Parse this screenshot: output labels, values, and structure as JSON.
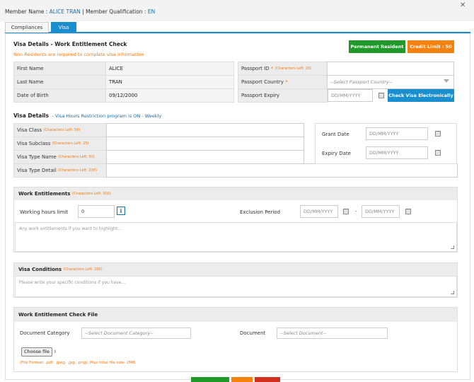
{
  "header": {
    "member_name_label": "Member Name : ",
    "member_name": "ALICE TRAN",
    "separator": " | ",
    "qual_label": "Member Qualification : ",
    "qual": "EN"
  },
  "tabs": [
    {
      "label": "Compliances"
    },
    {
      "label": "Visa"
    }
  ],
  "visa": {
    "title": "Visa Details - Work Entitlement Check",
    "notice": "Non-Residents are required to complete visa information",
    "permanent_btn": "Permanent Resident",
    "credit_btn": "Credit Limit : 50",
    "first_name_label": "First Name",
    "first_name": "ALICE",
    "last_name_label": "Last Name",
    "last_name": "TRAN",
    "dob_label": "Date of Birth",
    "dob": "09/12/2000",
    "passport_id_label": "Passport ID",
    "passport_id_req": "*",
    "passport_id_hint": "(Characters Left: 20)",
    "passport_country_label": "Passport Country",
    "passport_country_req": "*",
    "passport_country_ph": "--Select Passport Country--",
    "passport_expiry_label": "Passport Expiry",
    "passport_expiry_ph": "DD/MM/YYYY",
    "check_btn": "Check Visa Electronically"
  },
  "visa_details": {
    "title": "Visa Details",
    "program": "- Visa Hours Restriction program is ON - Weekly",
    "rows": [
      {
        "label": "Visa Class",
        "hint": "(Characters Left: 50)"
      },
      {
        "label": "Visa Subclass",
        "hint": "(Characters Left: 25)"
      },
      {
        "label": "Visa Type Name",
        "hint": "(Characters Left: 50)"
      },
      {
        "label": "Visa Type Detail",
        "hint": "(Characters Left: 200)"
      }
    ],
    "grant_label": "Grant Date",
    "grant_ph": "DD/MM/YYYY",
    "expiry_label": "Expiry Date",
    "expiry_ph": "DD/MM/YYYY"
  },
  "work": {
    "title": "Work Entitlements",
    "hint": "(Characters Left: 500)",
    "hours_label": "Working hours limit",
    "hours_value": "0",
    "info": "i",
    "exclusion_label": "Exclusion Period",
    "from_ph": "DD/MM/YYYY",
    "dash": "-",
    "to_ph": "DD/MM/YYYY",
    "textarea_ph": "Any work entitlements if you want to highlight..."
  },
  "conditions": {
    "title": "Visa Conditions",
    "hint": "(Characters Left: 200)",
    "textarea_ph": "Please write your specific conditions if you have..."
  },
  "file": {
    "title": "Work Entitlement Check File",
    "category_label": "Document Category",
    "category_ph": "--Select Document Category--",
    "document_label": "Document",
    "document_ph": "--Select Document--",
    "choose_btn": "Choose file",
    "choose_suffix": "I",
    "format_note": "(File Format: .pdf, .jpeg, .jpg, .png). Max total file size- 2MB."
  },
  "colors": {
    "tab_active": "#1a8fd0",
    "permanent": "#1f9a2a",
    "credit": "#f5820f",
    "check": "#1a8fd0",
    "hint": "#f07a10",
    "footer_green": "#1f9a2a",
    "footer_orange": "#f5820f",
    "footer_red": "#d03020"
  },
  "icons": {
    "close": "close-icon",
    "calendar": "calendar-icon",
    "info": "info-icon",
    "dropdown": "chevron-down-icon"
  }
}
